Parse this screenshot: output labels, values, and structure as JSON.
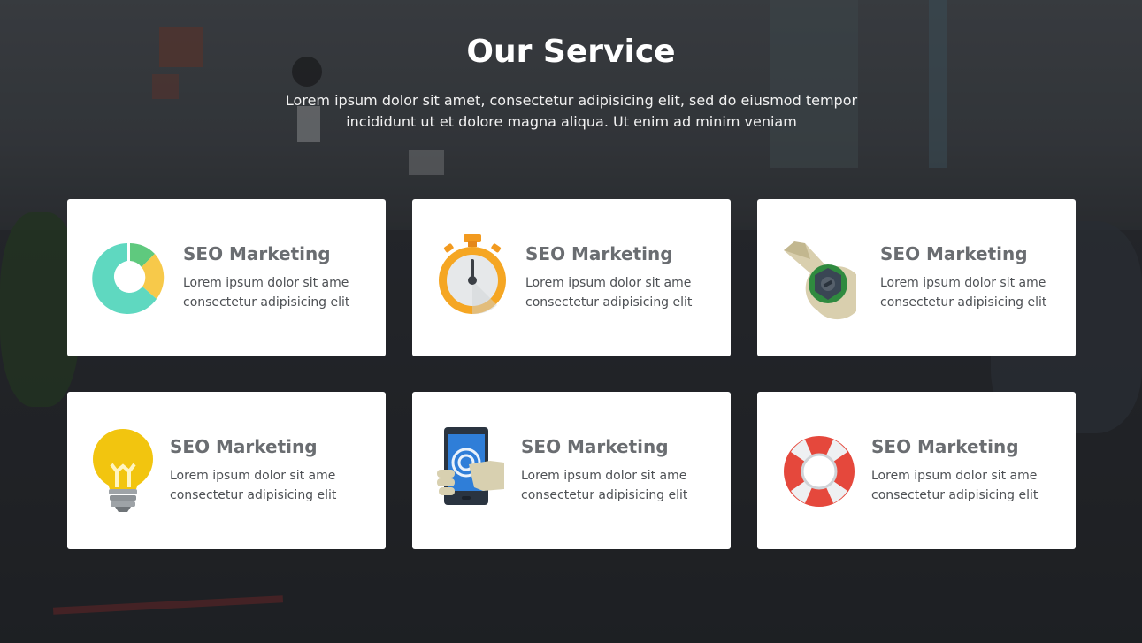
{
  "section": {
    "title": "Our Service",
    "intro": "Lorem ipsum dolor sit amet, consectetur adipisicing elit, sed do eiusmod tempor incididunt ut et dolore magna aliqua. Ut enim ad minim veniam"
  },
  "services": [
    {
      "icon": "donut-chart-icon",
      "title": "SEO Marketing",
      "text": "Lorem ipsum dolor sit ame consectetur adipisicing elit"
    },
    {
      "icon": "stopwatch-icon",
      "title": "SEO Marketing",
      "text": "Lorem ipsum dolor sit ame consectetur adipisicing elit"
    },
    {
      "icon": "wrench-icon",
      "title": "SEO Marketing",
      "text": "Lorem ipsum dolor sit ame consectetur adipisicing elit"
    },
    {
      "icon": "lightbulb-icon",
      "title": "SEO Marketing",
      "text": "Lorem ipsum dolor sit ame consectetur adipisicing elit"
    },
    {
      "icon": "smartphone-touch-icon",
      "title": "SEO Marketing",
      "text": "Lorem ipsum dolor sit ame consectetur adipisicing elit"
    },
    {
      "icon": "lifebuoy-icon",
      "title": "SEO Marketing",
      "text": "Lorem ipsum dolor sit ame consectetur adipisicing elit"
    }
  ],
  "colors": {
    "card_bg": "#ffffff",
    "title_text": "#6a6d71",
    "body_text": "#4d5054",
    "heading_text": "#ffffff"
  }
}
